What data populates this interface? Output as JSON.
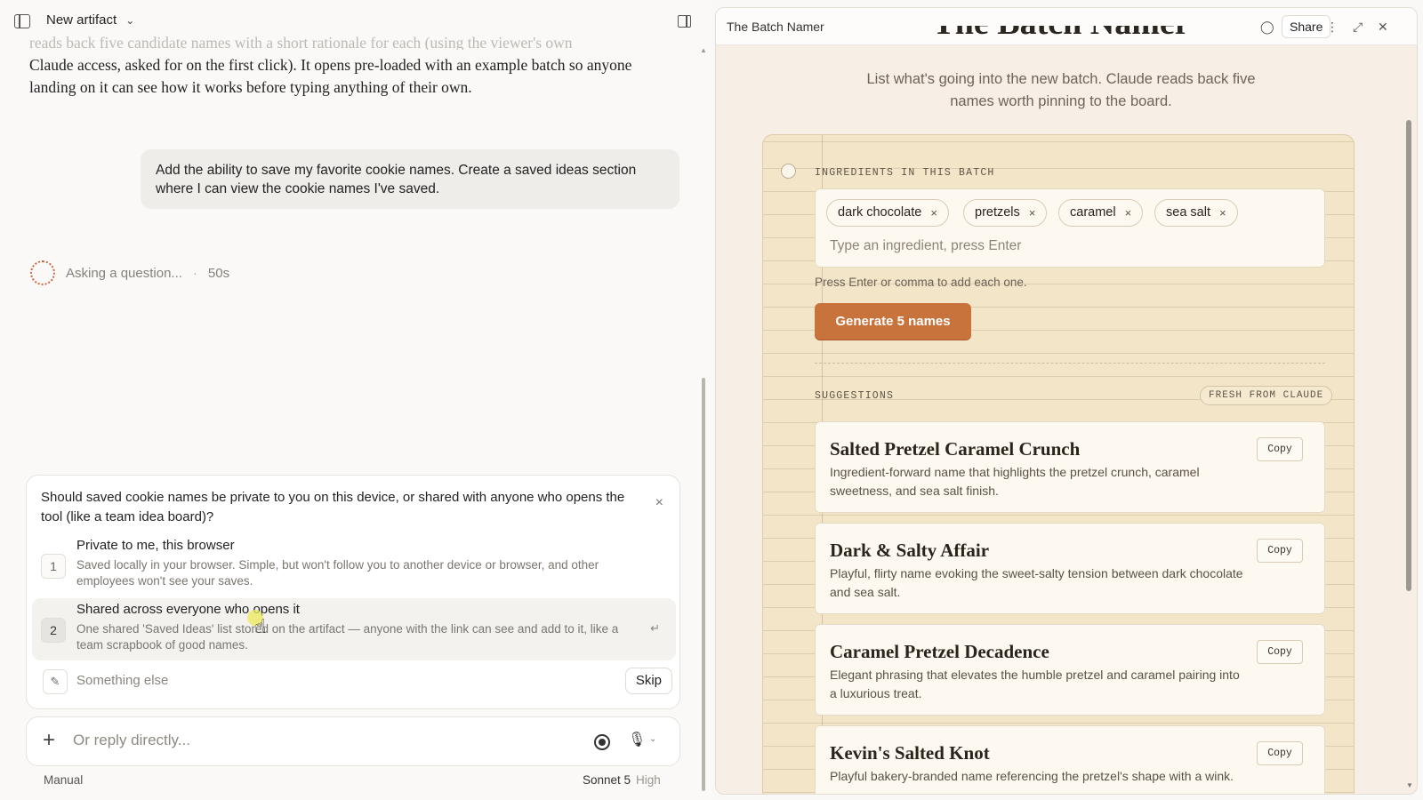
{
  "header": {
    "title": "New artifact"
  },
  "conversation": {
    "faded_line": "reads back five candidate names with a short rationale for each (using the viewer's own",
    "assistant_text": "Claude access, asked for on the first click). It opens pre-loaded with an example batch so anyone landing on it can see how it works before typing anything of their own.",
    "user_message": "Add the ability to save my favorite cookie names. Create a saved ideas section where I can view the cookie names I've saved.",
    "status_text": "Asking a question...",
    "status_sep": "·",
    "status_time": "50s"
  },
  "question": {
    "text": "Should saved cookie names be private to you on this device, or shared with anyone who opens the tool (like a team idea board)?",
    "close_icon": "×",
    "options": [
      {
        "num": "1",
        "title": "Private to me, this browser",
        "desc": "Saved locally in your browser. Simple, but won't follow you to another device or browser, and other employees won't see your saves."
      },
      {
        "num": "2",
        "title": "Shared across everyone who opens it",
        "desc": "One shared 'Saved Ideas' list stored on the artifact — anyone with the link can see and add to it, like a team scrapbook of good names."
      }
    ],
    "enter_icon": "↵",
    "something_else": "Something else",
    "skip_label": "Skip"
  },
  "composer": {
    "plus_icon": "+",
    "placeholder": "Or reply directly...",
    "mode": "Manual",
    "model": "Sonnet 5",
    "effort": "High"
  },
  "artifact": {
    "title": "The Batch Namer",
    "share_label": "Share",
    "page_title": "The Batch Namer",
    "subtitle": "List what's going into the new batch. Claude reads back five names worth pinning to the board.",
    "ingredients_label": "INGREDIENTS IN THIS BATCH",
    "ingredients": [
      "dark chocolate",
      "pretzels",
      "caramel",
      "sea salt"
    ],
    "chip_remove": "×",
    "ingredient_placeholder": "Type an ingredient, press Enter",
    "hint": "Press Enter or comma to add each one.",
    "generate_label": "Generate 5 names",
    "suggestions_label": "SUGGESTIONS",
    "fresh_badge": "FRESH FROM CLAUDE",
    "copy_label": "Copy",
    "suggestions": [
      {
        "name": "Salted Pretzel Caramel Crunch",
        "desc": "Ingredient-forward name that highlights the pretzel crunch, caramel sweetness, and sea salt finish."
      },
      {
        "name": "Dark & Salty Affair",
        "desc": "Playful, flirty name evoking the sweet-salty tension between dark chocolate and sea salt."
      },
      {
        "name": "Caramel Pretzel Decadence",
        "desc": "Elegant phrasing that elevates the humble pretzel and caramel pairing into a luxurious treat."
      },
      {
        "name": "Kevin's Salted Knot",
        "desc": "Playful bakery-branded name referencing the pretzel's shape with a wink."
      }
    ]
  },
  "colors": {
    "accent": "#c9733c",
    "paper": "#f3e6c8",
    "spinner": "#c9683f"
  }
}
